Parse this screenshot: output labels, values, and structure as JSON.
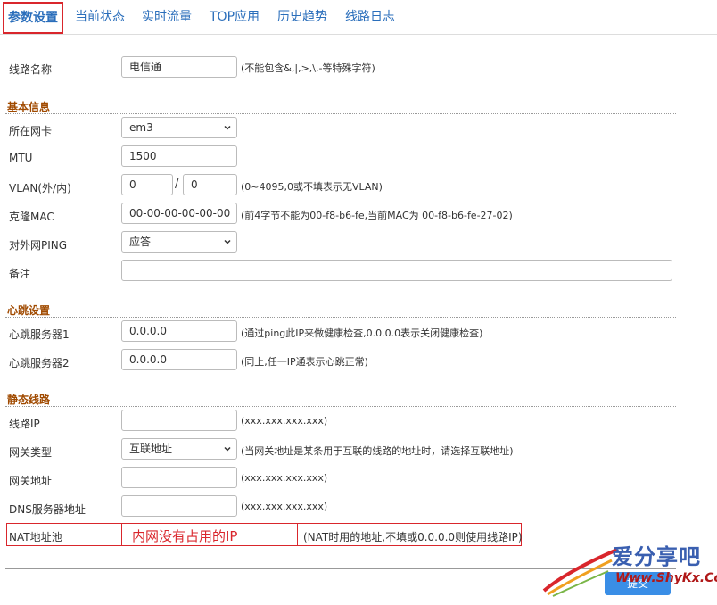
{
  "tabs": [
    {
      "label": "参数设置",
      "active": true
    },
    {
      "label": "当前状态"
    },
    {
      "label": "实时流量"
    },
    {
      "label": "TOP应用"
    },
    {
      "label": "历史趋势"
    },
    {
      "label": "线路日志"
    }
  ],
  "line_name": {
    "label": "线路名称",
    "value": "电信通",
    "hint": "(不能包含&,|,>,\\,-等特殊字符)"
  },
  "basic": {
    "title": "基本信息",
    "nic": {
      "label": "所在网卡",
      "value": "em3"
    },
    "mtu": {
      "label": "MTU",
      "value": "1500"
    },
    "vlan": {
      "label": "VLAN(外/内)",
      "outer": "0",
      "sep": "/",
      "inner": "0",
      "hint": "(0~4095,0或不填表示无VLAN)"
    },
    "mac": {
      "label": "克隆MAC",
      "value": "00-00-00-00-00-00",
      "hint": "(前4字节不能为00-f8-b6-fe,当前MAC为 00-f8-b6-fe-27-02)"
    },
    "ping": {
      "label": "对外网PING",
      "value": "应答"
    },
    "remark": {
      "label": "备注",
      "value": ""
    }
  },
  "heartbeat": {
    "title": "心跳设置",
    "server1": {
      "label": "心跳服务器1",
      "value": "0.0.0.0",
      "hint": "(通过ping此IP来做健康检查,0.0.0.0表示关闭健康检查)"
    },
    "server2": {
      "label": "心跳服务器2",
      "value": "0.0.0.0",
      "hint": "(同上,任一IP通表示心跳正常)"
    }
  },
  "static": {
    "title": "静态线路",
    "ip": {
      "label": "线路IP",
      "value": "",
      "hint": "(xxx.xxx.xxx.xxx)"
    },
    "gw_type": {
      "label": "网关类型",
      "value": "互联地址",
      "hint": "(当网关地址是某条用于互联的线路的地址时，请选择互联地址)"
    },
    "gw_addr": {
      "label": "网关地址",
      "value": "",
      "hint": "(xxx.xxx.xxx.xxx)"
    },
    "dns": {
      "label": "DNS服务器地址",
      "value": "",
      "hint": "(xxx.xxx.xxx.xxx)"
    },
    "nat": {
      "label": "NAT地址池",
      "annotation": "内网没有占用的IP",
      "hint": "(NAT时用的地址,不填或0.0.0.0则使用线路IP)"
    }
  },
  "submit_label": "提交",
  "watermark": {
    "top": "爱分享吧",
    "bottom": "Www.ShyKx.Com"
  },
  "colors": {
    "accent": "#2a6ebb",
    "section": "#a04a00",
    "highlight": "#d9262c"
  }
}
